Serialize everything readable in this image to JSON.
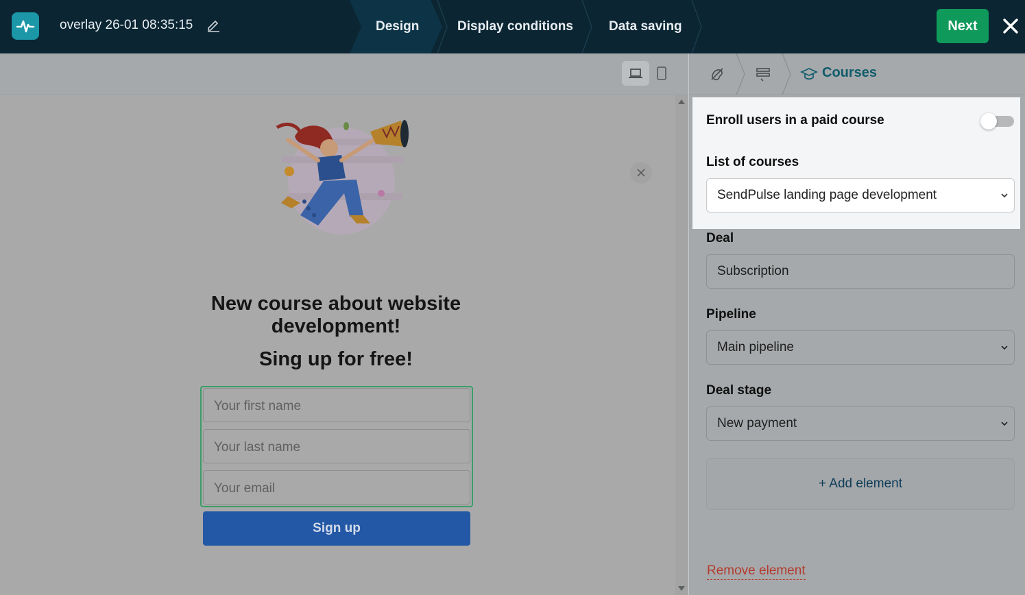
{
  "header": {
    "document_title": "overlay 26-01 08:35:15",
    "steps": [
      "Design",
      "Display conditions",
      "Data saving"
    ],
    "next_label": "Next"
  },
  "canvas": {
    "heading": "New course about website development!",
    "subheading": "Sing up for free!",
    "fields": [
      {
        "placeholder": "Your first name"
      },
      {
        "placeholder": "Your last name"
      },
      {
        "placeholder": "Your email"
      }
    ],
    "submit_label": "Sign up"
  },
  "panel": {
    "breadcrumb_current": "Courses",
    "enroll_label": "Enroll users in a paid course",
    "enroll_enabled": false,
    "list_label": "List of courses",
    "list_value": "SendPulse landing page development",
    "deal_label": "Deal",
    "deal_value": "Subscription",
    "pipeline_label": "Pipeline",
    "pipeline_value": "Main pipeline",
    "stage_label": "Deal stage",
    "stage_value": "New payment",
    "add_element_label": "+ Add element",
    "remove_element_label": "Remove element"
  },
  "colors": {
    "topbar": "#0b2533",
    "next_button": "#0f9a5b",
    "signup_button": "#2358a6",
    "form_border": "#3a9d6a",
    "breadcrumb_active": "#0f5c6b",
    "remove_link": "#b33a2e"
  },
  "icons": [
    "pulse-logo-icon",
    "pencil-icon",
    "close-icon",
    "desktop-icon",
    "mobile-icon",
    "design-style-icon",
    "form-fields-icon",
    "graduation-cap-icon",
    "chevron-down-icon"
  ]
}
